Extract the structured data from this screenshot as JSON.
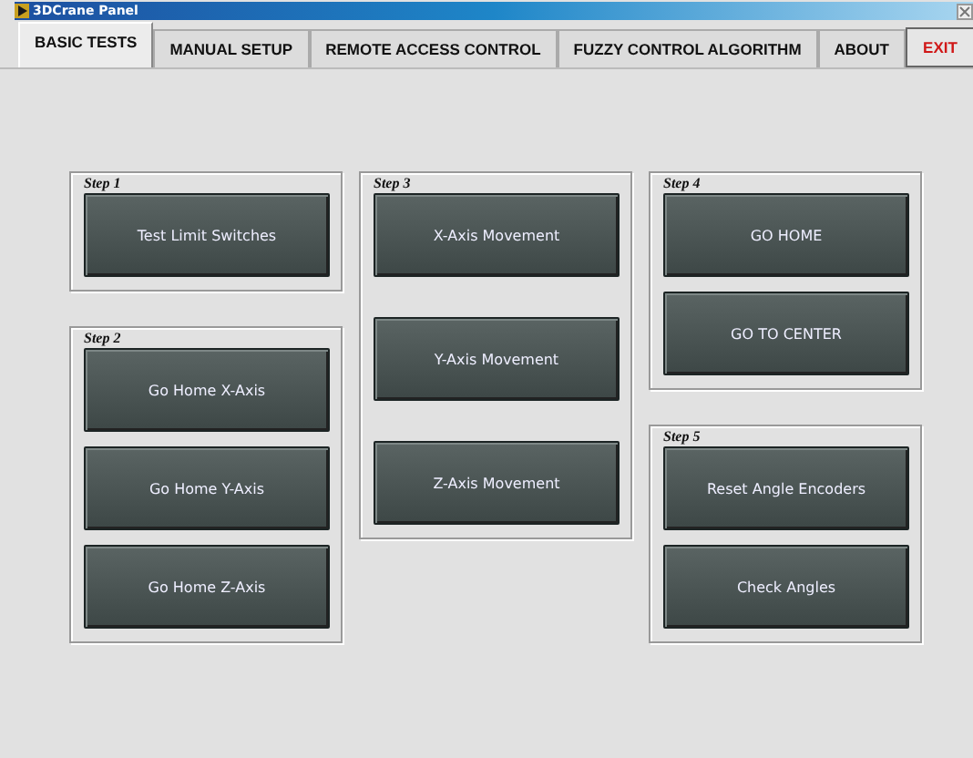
{
  "window": {
    "title": "3DCrane Panel"
  },
  "tabs": [
    {
      "label": "BASIC TESTS",
      "kind": "tab",
      "selected": true
    },
    {
      "label": "MANUAL SETUP",
      "kind": "tab",
      "selected": false
    },
    {
      "label": "REMOTE ACCESS CONTROL",
      "kind": "tab",
      "selected": false
    },
    {
      "label": "FUZZY CONTROL ALGORITHM",
      "kind": "tab",
      "selected": false
    },
    {
      "label": "ABOUT",
      "kind": "tab",
      "selected": false
    },
    {
      "label": "EXIT",
      "kind": "button",
      "selected": false
    }
  ],
  "columns": [
    {
      "groups": [
        {
          "title": "Step 1",
          "kind": "stacked",
          "buttons": [
            "Test Limit Switches"
          ]
        },
        {
          "title": "Step 2",
          "kind": "stacked",
          "buttons": [
            "Go Home X-Axis",
            "Go Home Y-Axis",
            "Go Home Z-Axis"
          ]
        }
      ]
    },
    {
      "groups": [
        {
          "title": "Step 3",
          "kind": "spread",
          "buttons": [
            "X-Axis Movement",
            "Y-Axis Movement",
            "Z-Axis Movement"
          ]
        }
      ]
    },
    {
      "groups": [
        {
          "title": "Step 4",
          "kind": "stacked",
          "buttons": [
            "GO HOME",
            "GO TO CENTER"
          ]
        },
        {
          "title": "Step 5",
          "kind": "stacked",
          "buttons": [
            "Reset Angle Encoders",
            "Check Angles"
          ]
        }
      ]
    }
  ]
}
